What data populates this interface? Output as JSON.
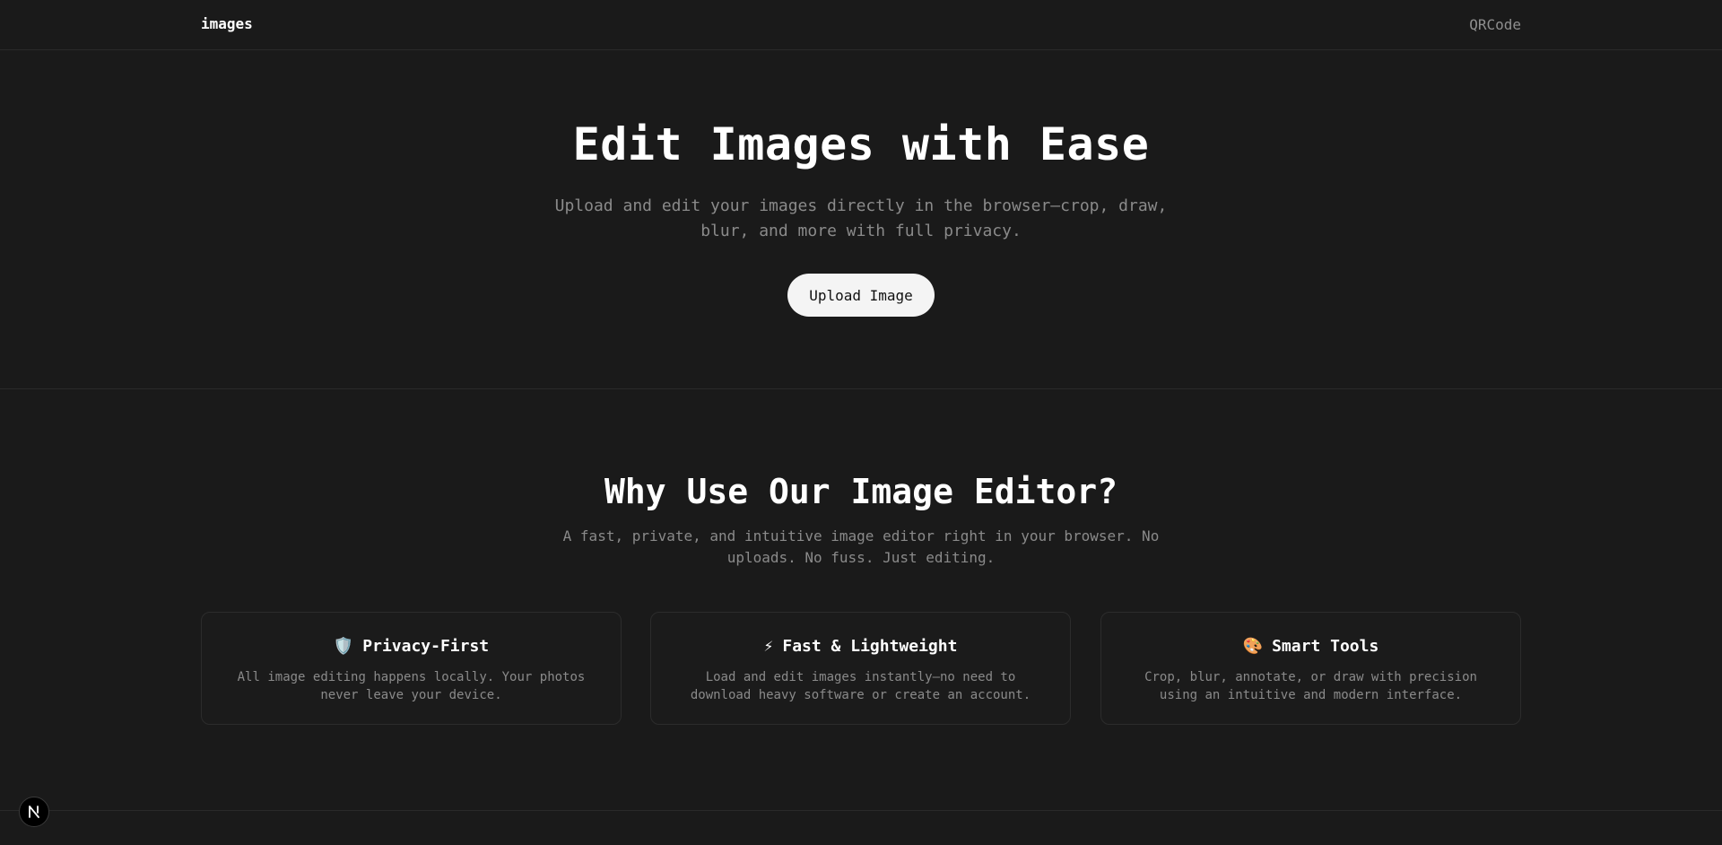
{
  "header": {
    "brand": "images",
    "nav_link": "QRCode"
  },
  "hero": {
    "title": "Edit Images with Ease",
    "subtitle": "Upload and edit your images directly in the browser—crop, draw, blur, and more with full privacy.",
    "upload_label": "Upload Image"
  },
  "features": {
    "title": "Why Use Our Image Editor?",
    "subtitle": "A fast, private, and intuitive image editor right in your browser. No uploads. No fuss. Just editing.",
    "cards": [
      {
        "icon": "shield-icon",
        "emoji": "🛡️",
        "title": "Privacy-First",
        "description": "All image editing happens locally. Your photos never leave your device."
      },
      {
        "icon": "lightning-icon",
        "emoji": "⚡",
        "title": "Fast & Lightweight",
        "description": "Load and edit images instantly—no need to download heavy software or create an account."
      },
      {
        "icon": "palette-icon",
        "emoji": "🎨",
        "title": "Smart Tools",
        "description": "Crop, blur, annotate, or draw with precision using an intuitive and modern interface."
      }
    ]
  },
  "dev_badge": {
    "icon": "nextjs-icon"
  },
  "colors": {
    "background": "#1a1a1a",
    "text": "#ededed",
    "muted": "#8a8a8a",
    "button_bg": "#f4f4f4"
  }
}
